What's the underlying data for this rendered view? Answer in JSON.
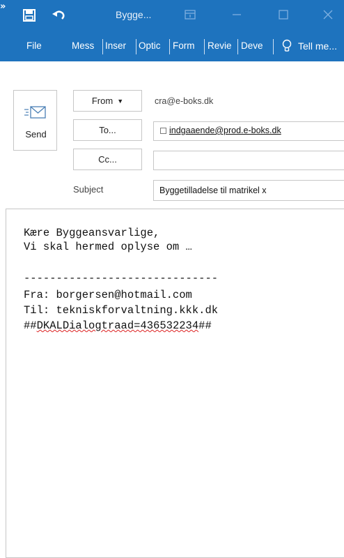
{
  "titlebar": {
    "title": "Bygge...",
    "more_glyph": "»",
    "icons": [
      "save-icon",
      "undo-icon",
      "ribbon-display-icon",
      "minimize-icon",
      "maximize-icon",
      "close-icon"
    ]
  },
  "ribbon": {
    "tabs": [
      "File",
      "Mess",
      "Inser",
      "Optic",
      "Form",
      "Revie",
      "Deve"
    ],
    "tell_me": "Tell me..."
  },
  "compose": {
    "send_label": "Send",
    "from_label": "From",
    "from_value": "cra@e-boks.dk",
    "to_label": "To...",
    "to_value": "indgaaende@prod.e-boks.dk",
    "cc_label": "Cc...",
    "cc_value": "",
    "subject_label": "Subject",
    "subject_value": "Byggetilladelse til matrikel x"
  },
  "body": {
    "line1": "Kære Byggeansvarlige,",
    "line2": "Vi skal hermed oplyse om …",
    "separator": "------------------------------",
    "from_line": "Fra: borgersen@hotmail.com",
    "to_line": "Til: tekniskforvaltning.kkk.dk",
    "tag_prefix": "##",
    "tag_underlined": "DKALDialogtraad=436532234",
    "tag_suffix": "##"
  },
  "colors": {
    "accent": "#1e73be",
    "spellcheck": "#d22222"
  }
}
